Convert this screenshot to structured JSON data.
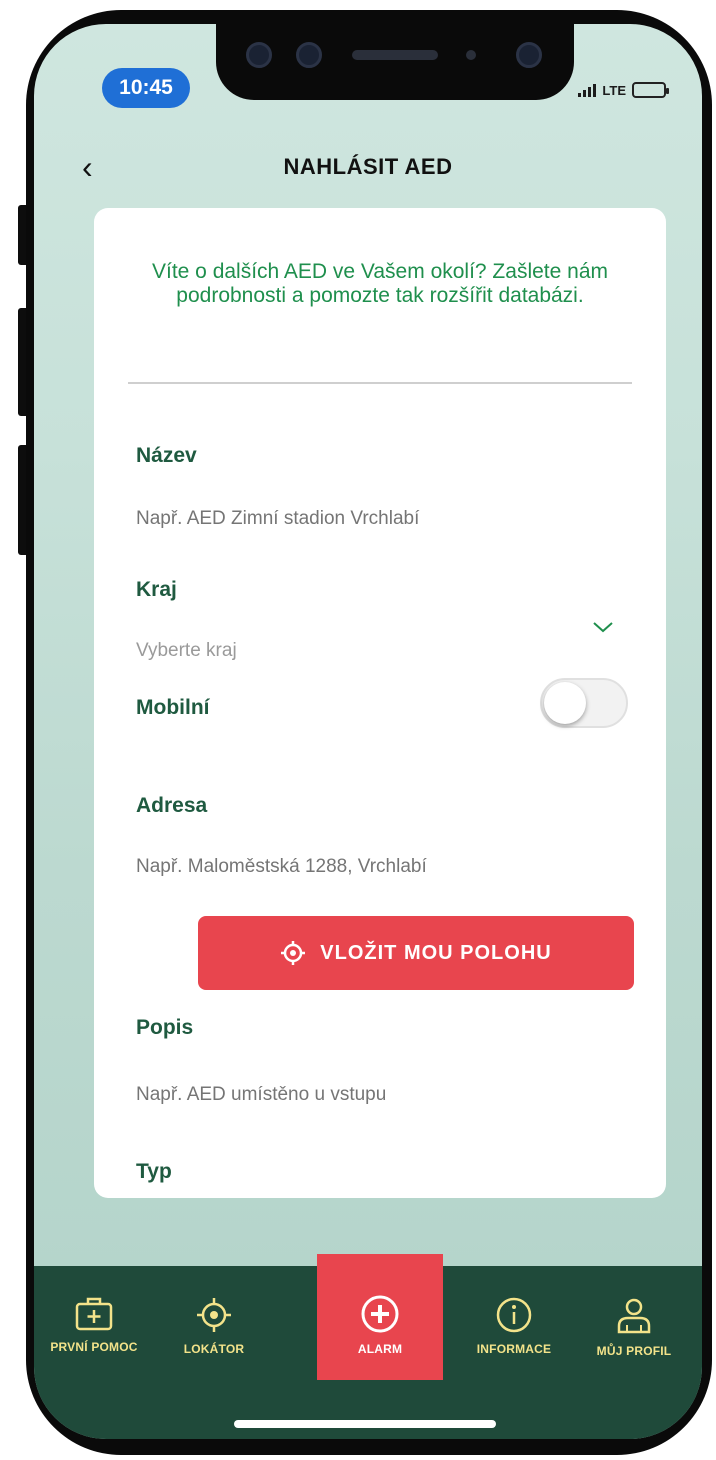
{
  "status_bar": {
    "time": "10:45",
    "network": "LTE"
  },
  "header": {
    "back_label": "‹",
    "title": "NAHLÁSIT AED"
  },
  "intro": {
    "text": "Víte o dalších AED ve Vašem okolí? Zašlete nám podrobnosti a pomozte tak rozšířit databázi."
  },
  "form": {
    "name": {
      "label": "Název",
      "placeholder": "Např. AED Zimní stadion Vrchlabí"
    },
    "region": {
      "label": "Kraj",
      "value": "Vyberte kraj"
    },
    "mobile": {
      "label": "Mobilní",
      "on": false
    },
    "address": {
      "label": "Adresa",
      "placeholder": "Např. Maloměstská 1288, Vrchlabí"
    },
    "location_button": {
      "label": "VLOŽIT MOU POLOHU"
    },
    "description": {
      "label": "Popis",
      "placeholder": "Např. AED umístěno u vstupu"
    },
    "type": {
      "label": "Typ"
    }
  },
  "tabbar": {
    "items": [
      {
        "label": "PRVNÍ POMOC",
        "icon": "first-aid-kit-icon"
      },
      {
        "label": "LOKÁTOR",
        "icon": "locator-icon"
      },
      {
        "label": "ALARM",
        "icon": "alarm-plus-icon",
        "active": true
      },
      {
        "label": "INFORMACE",
        "icon": "info-icon"
      },
      {
        "label": "MŮJ PROFIL",
        "icon": "profile-icon"
      }
    ]
  },
  "colors": {
    "accent_red": "#e8454e",
    "brand_green": "#1f5a40",
    "tabbar_bg": "#1f4a3a",
    "tab_icon_yellow": "#f3e38a"
  }
}
